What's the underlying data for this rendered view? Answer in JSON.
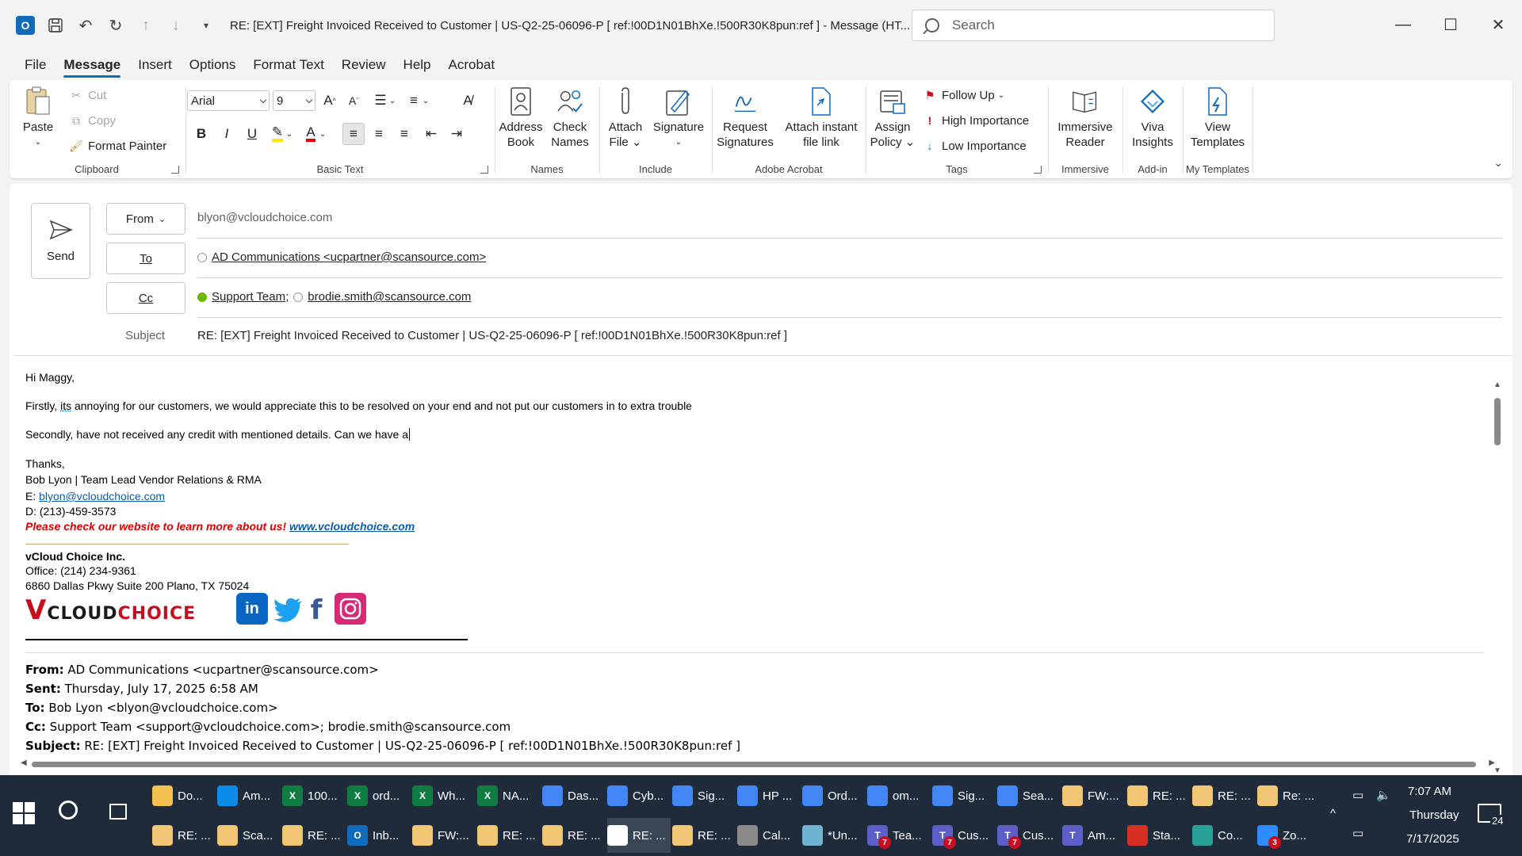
{
  "titlebar": {
    "title": "RE: [EXT] Freight Invoiced Received to Customer | US-Q2-25-06096-P    [ ref:!00D1N01BhXe.!500R30K8pun:ref ]  -  Message (HT...",
    "search_placeholder": "Search"
  },
  "menu": {
    "tabs": [
      "File",
      "Message",
      "Insert",
      "Options",
      "Format Text",
      "Review",
      "Help",
      "Acrobat"
    ]
  },
  "ribbon": {
    "clipboard": {
      "paste": "Paste",
      "cut": "Cut",
      "copy": "Copy",
      "format_painter": "Format Painter",
      "label": "Clipboard"
    },
    "basic_text": {
      "font": "Arial",
      "size": "9",
      "label": "Basic Text"
    },
    "names": {
      "address_book_1": "Address",
      "address_book_2": "Book",
      "check_names_1": "Check",
      "check_names_2": "Names",
      "label": "Names"
    },
    "include": {
      "attach_1": "Attach",
      "attach_2": "File",
      "signature": "Signature",
      "label": "Include"
    },
    "acrobat": {
      "request_1": "Request",
      "request_2": "Signatures",
      "attach_link_1": "Attach instant",
      "attach_link_2": "file link",
      "label": "Adobe Acrobat"
    },
    "tags": {
      "assign_1": "Assign",
      "assign_2": "Policy",
      "follow_up": "Follow Up",
      "high": "High Importance",
      "low": "Low Importance",
      "label": "Tags"
    },
    "immersive": {
      "btn_1": "Immersive",
      "btn_2": "Reader",
      "label": "Immersive"
    },
    "addin": {
      "btn_1": "Viva",
      "btn_2": "Insights",
      "label": "Add-in"
    },
    "templates": {
      "btn_1": "View",
      "btn_2": "Templates",
      "label": "My Templates"
    }
  },
  "compose": {
    "send": "Send",
    "from_label": "From",
    "from_value": "blyon@vcloudchoice.com",
    "to_label": "To",
    "to_value": "AD Communications <ucpartner@scansource.com>",
    "cc_label": "Cc",
    "cc_1": "Support Team;",
    "cc_2": "brodie.smith@scansource.com",
    "subject_label": "Subject",
    "subject_value": "RE: [EXT] Freight Invoiced Received to Customer | US-Q2-25-06096-P    [ ref:!00D1N01BhXe.!500R30K8pun:ref ]"
  },
  "body": {
    "greeting": "Hi Maggy,",
    "line1_a": "Firstly, ",
    "line1_its": "its",
    "line1_b": " annoying for our customers, we would appreciate this to be resolved on your end and not put our customers in to extra trouble",
    "line2": "Secondly, have not received any credit with mentioned details. Can we have a",
    "thanks": "Thanks,",
    "sig_name": "Bob Lyon | Team Lead Vendor Relations & RMA",
    "sig_email_label": "E: ",
    "sig_email": "blyon@vcloudchoice.com",
    "sig_phone": "D: (213)-459-3573",
    "sig_promo": "Please check our website to learn more about us! ",
    "sig_website": "www.vcloudchoice.com",
    "company": "vCloud Choice Inc.",
    "office": "Office: (214) 234-9361",
    "address": "6860 Dallas Pkwy Suite 200 Plano, TX 75024",
    "logo_v": "V",
    "logo_cloud": "CLOUD",
    "logo_choice": "CHOICE",
    "social_in": "in",
    "social_f": "f"
  },
  "quoted": {
    "from_label": "From:",
    "from": " AD Communications <ucpartner@scansource.com>",
    "sent_label": "Sent:",
    "sent": " Thursday, July 17, 2025 6:58 AM",
    "to_label": "To:",
    "to": " Bob Lyon <blyon@vcloudchoice.com>",
    "cc_label": "Cc:",
    "cc": " Support Team <support@vcloudchoice.com>; brodie.smith@scansource.com",
    "subject_label": "Subject:",
    "subject": " RE: [EXT] Freight Invoiced Received to Customer | US-Q2-25-06096-P [ ref:!00D1N01BhXe.!500R30K8pun:ref ]"
  },
  "taskbar": {
    "row1": [
      "Do...",
      "Am...",
      "100...",
      "ord...",
      "Wh...",
      "NA...",
      "Das...",
      "Cyb...",
      "Sig...",
      "HP ...",
      "Ord...",
      "om...",
      "Sig...",
      "Sea...",
      "FW:...",
      "RE: ...",
      "RE: ...",
      "Re: ..."
    ],
    "row2": [
      "RE: ...",
      "Sca...",
      "RE: ...",
      "Inb...",
      "FW:...",
      "RE: ...",
      "RE: ...",
      "RE: ...",
      "RE: ...",
      "Cal...",
      "*Un...",
      "Tea...",
      "Cus...",
      "Cus...",
      "Am...",
      "Sta...",
      "Co...",
      "Zo..."
    ],
    "time": "7:07 AM",
    "day": "Thursday",
    "date": "7/17/2025",
    "notif_count": "24",
    "badge_7": "7",
    "badge_3": "3"
  },
  "colors": {
    "accent": "#0f6cbd",
    "promo_red": "#e00000",
    "taskbar": "#1f2a3a"
  }
}
